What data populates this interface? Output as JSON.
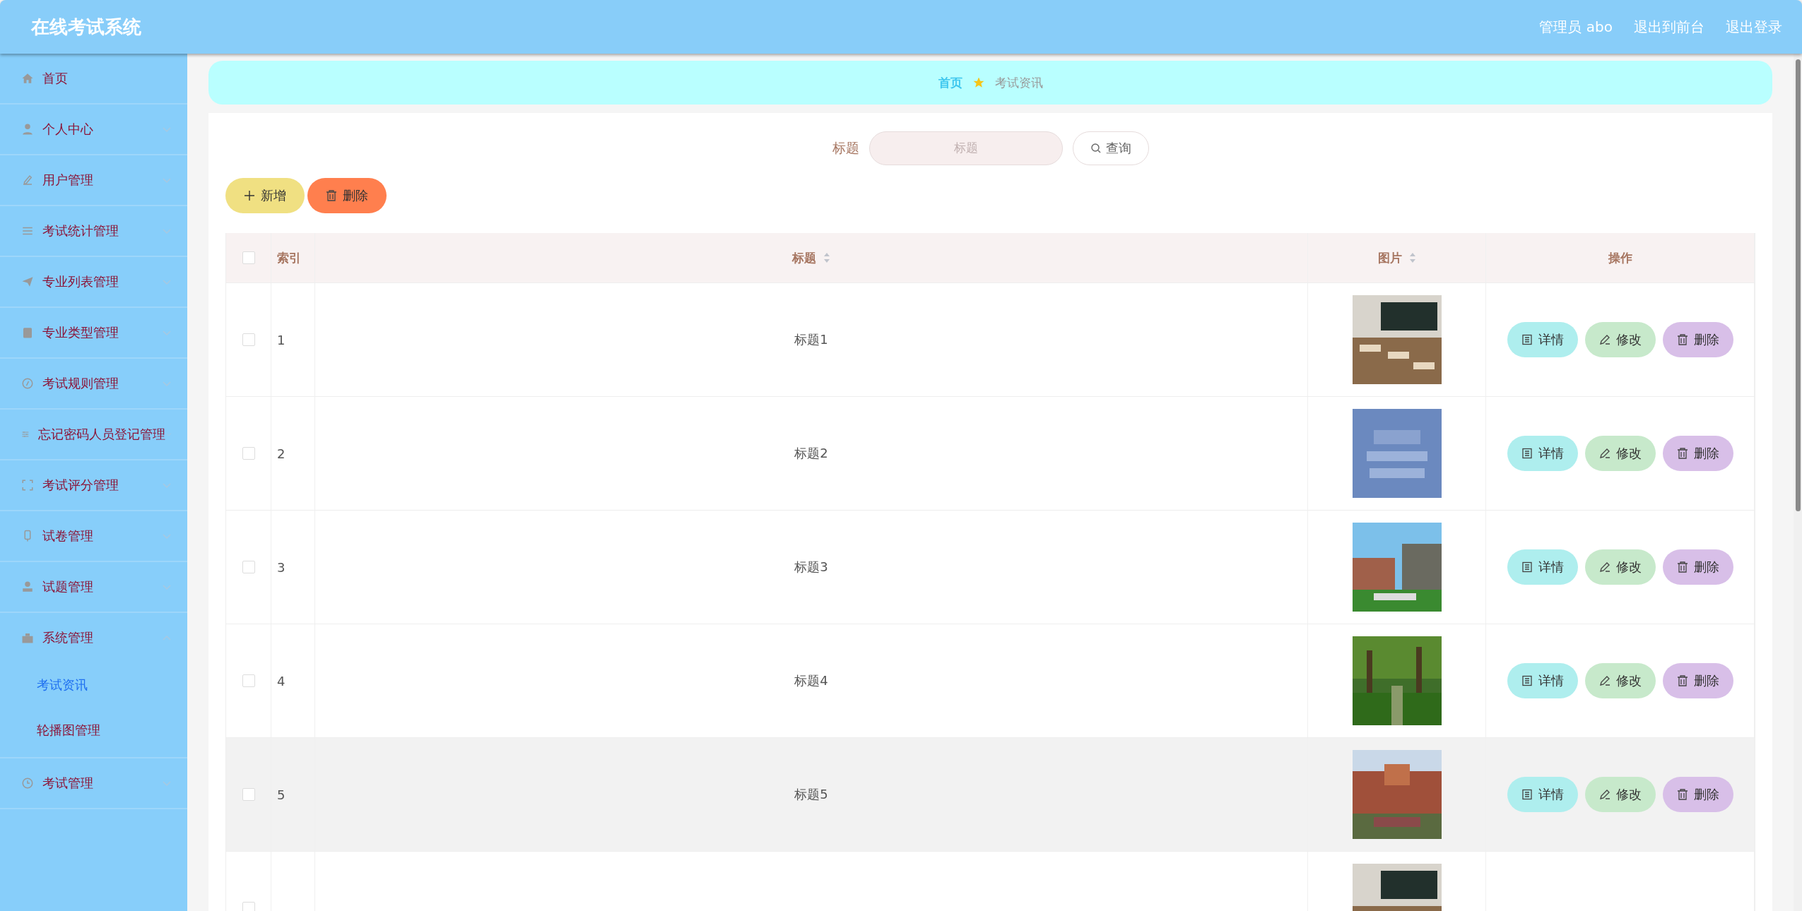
{
  "header": {
    "title": "在线考试系统",
    "links": [
      "管理员 abo",
      "退出到前台",
      "退出登录"
    ]
  },
  "sidebar": {
    "items": [
      {
        "label": "首页",
        "kind": "link"
      },
      {
        "label": "个人中心",
        "kind": "menu",
        "expanded": false
      },
      {
        "label": "用户管理",
        "kind": "menu",
        "expanded": false
      },
      {
        "label": "考试统计管理",
        "kind": "menu",
        "expanded": false
      },
      {
        "label": "专业列表管理",
        "kind": "menu",
        "expanded": false
      },
      {
        "label": "专业类型管理",
        "kind": "menu",
        "expanded": false
      },
      {
        "label": "考试规则管理",
        "kind": "menu",
        "expanded": false
      },
      {
        "label": "忘记密码人员登记管理",
        "kind": "menu",
        "expanded": false
      },
      {
        "label": "考试评分管理",
        "kind": "menu",
        "expanded": false
      },
      {
        "label": "试卷管理",
        "kind": "menu",
        "expanded": false
      },
      {
        "label": "试题管理",
        "kind": "menu",
        "expanded": false
      },
      {
        "label": "系统管理",
        "kind": "menu",
        "expanded": true,
        "children": [
          {
            "label": "考试资讯",
            "selected": true
          },
          {
            "label": "轮播图管理",
            "selected": false
          }
        ]
      },
      {
        "label": "考试管理",
        "kind": "menu",
        "expanded": false
      }
    ]
  },
  "breadcrumb": [
    "首页",
    "考试资讯"
  ],
  "search": {
    "label": "标题",
    "placeholder": "标题",
    "button": "查询"
  },
  "actions": [
    {
      "label": "新增",
      "kind": "add"
    },
    {
      "label": "删除",
      "kind": "delete"
    }
  ],
  "table": {
    "columns": [
      {
        "label": "索引",
        "sortable": false
      },
      {
        "label": "标题",
        "sortable": true
      },
      {
        "label": "图片",
        "sortable": true
      },
      {
        "label": "操作",
        "sortable": false
      }
    ],
    "header_checked": false,
    "rows": [
      {
        "checked": false,
        "hovered": false,
        "index": "1",
        "title": "标题1",
        "picture": {
          "kind": "picture"
        },
        "actions": [
          "详情",
          "修改",
          "删除"
        ]
      },
      {
        "checked": false,
        "hovered": false,
        "index": "2",
        "title": "标题2",
        "picture": {
          "kind": "picture"
        },
        "actions": [
          "详情",
          "修改",
          "删除"
        ]
      },
      {
        "checked": false,
        "hovered": false,
        "index": "3",
        "title": "标题3",
        "picture": {
          "kind": "picture"
        },
        "actions": [
          "详情",
          "修改",
          "删除"
        ]
      },
      {
        "checked": false,
        "hovered": false,
        "index": "4",
        "title": "标题4",
        "picture": {
          "kind": "picture"
        },
        "actions": [
          "详情",
          "修改",
          "删除"
        ]
      },
      {
        "checked": false,
        "hovered": true,
        "index": "5",
        "title": "标题5",
        "picture": {
          "kind": "picture"
        },
        "actions": [
          "详情",
          "修改",
          "删除"
        ]
      },
      {
        "checked": false,
        "hovered": false,
        "picture": {
          "kind": "picture"
        }
      }
    ]
  }
}
